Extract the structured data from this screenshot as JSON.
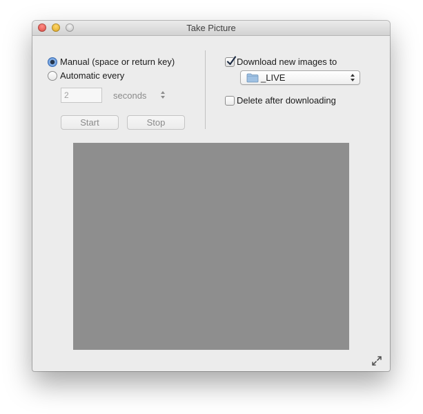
{
  "window": {
    "title": "Take Picture"
  },
  "capture": {
    "mode_manual_label": "Manual (space or return key)",
    "mode_automatic_label": "Automatic every",
    "selected_mode": "manual",
    "interval_value": "2",
    "interval_unit_label": "seconds",
    "start_label": "Start",
    "stop_label": "Stop"
  },
  "download": {
    "download_label": "Download new images to",
    "download_checked": true,
    "folder_name": "_LIVE",
    "delete_label": "Delete after downloading",
    "delete_checked": false
  },
  "icons": {
    "folder": "folder-icon",
    "popup_arrows": "up-down-chevron-icon",
    "resize": "fullscreen-expand-icon"
  },
  "colors": {
    "accent": "#4d86d6",
    "preview_background": "#8e8e8e",
    "window_background": "#ececec"
  }
}
